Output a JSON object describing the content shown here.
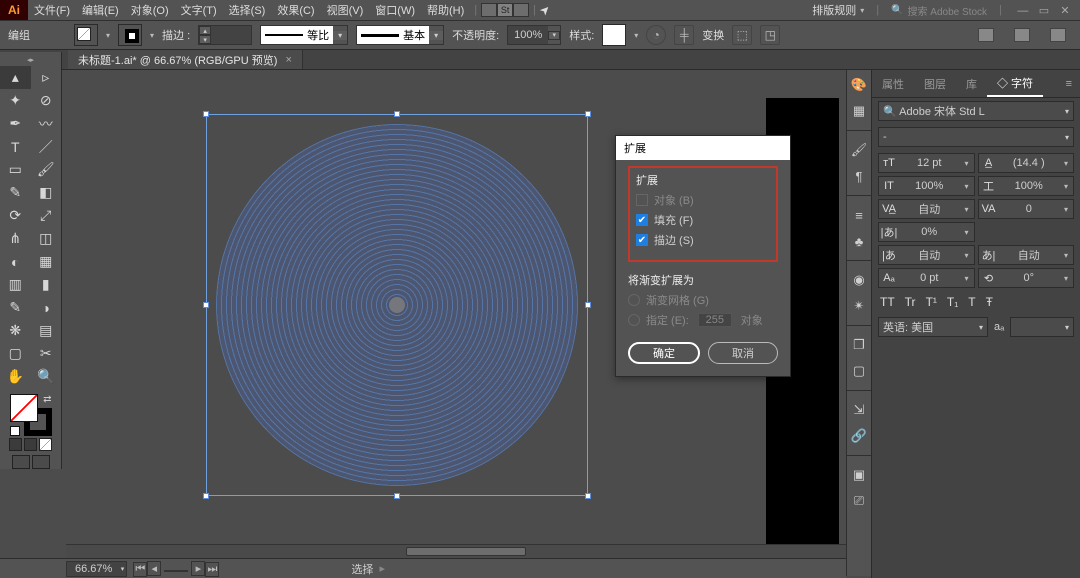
{
  "app": {
    "logo": "Ai"
  },
  "menu": {
    "items": [
      "文件(F)",
      "编辑(E)",
      "对象(O)",
      "文字(T)",
      "选择(S)",
      "效果(C)",
      "视图(V)",
      "窗口(W)",
      "帮助(H)"
    ],
    "layout_label": "排版规则",
    "search_placeholder": "搜索 Adobe Stock"
  },
  "optbar": {
    "left_label": "编组",
    "stroke_label": "描边 :",
    "stroke_profile": "等比",
    "brush_profile": "基本",
    "opacity_label": "不透明度:",
    "opacity_value": "100%",
    "style_label": "样式:",
    "transform_label": "变换"
  },
  "doc_tab": {
    "title": "未标题-1.ai* @ 66.67% (RGB/GPU 预览)",
    "close": "×"
  },
  "dialog": {
    "title": "扩展",
    "section1": "扩展",
    "opt_object": "对象 (B)",
    "opt_fill": "填充 (F)",
    "opt_stroke": "描边 (S)",
    "section2": "将渐变扩展为",
    "opt_mesh": "渐变网格 (G)",
    "opt_specify": "指定 (E):",
    "specify_value": "255",
    "specify_unit": "对象",
    "ok": "确定",
    "cancel": "取消"
  },
  "status": {
    "zoom": "66.67%",
    "mode": "选择"
  },
  "char_panel": {
    "tabs": [
      "属性",
      "图层",
      "库",
      "◇ 字符"
    ],
    "active_tab": 3,
    "font_family": "Adobe 宋体 Std L",
    "font_style": "-",
    "size_label": "T",
    "size": "12 pt",
    "leading_label": "A",
    "leading": "(14.4 )",
    "vscale_label": "IT",
    "vscale": "100%",
    "hscale_label": "工",
    "hscale": "100%",
    "kern_label": "VA",
    "kern": "自动",
    "track_label": "VA",
    "track": "0",
    "pct": "0%",
    "snap_label": "あ",
    "snap": "自动",
    "baseline_label": "Aa",
    "baseline": "0 pt",
    "rot_label": "⟲",
    "rotation": "0°",
    "styles": [
      "TT",
      "Tr",
      "T¹",
      "T₁",
      "T",
      "Ŧ"
    ],
    "lang": "英语: 美国",
    "aa": "aₐ"
  },
  "right_strip_icons": [
    "palette",
    "swatch",
    "brush",
    "pantone",
    "symbol",
    "gradient",
    "sparkle",
    "layers",
    "artboard",
    "asset",
    "link",
    "history",
    "css"
  ]
}
